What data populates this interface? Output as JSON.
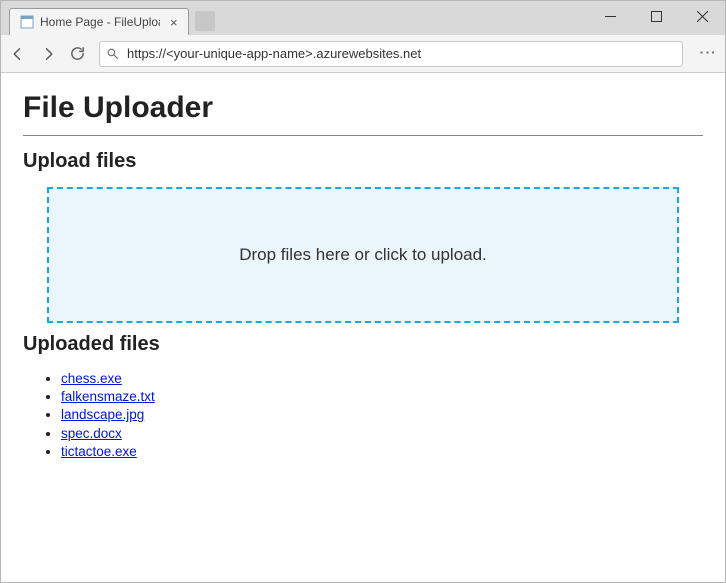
{
  "browser": {
    "tab_title": "Home Page - FileUploade",
    "url": "https://<your-unique-app-name>.azurewebsites.net"
  },
  "page": {
    "heading": "File Uploader",
    "upload_section_heading": "Upload files",
    "dropzone_text": "Drop files here or click to upload.",
    "uploaded_section_heading": "Uploaded files",
    "uploaded_files": [
      {
        "name": "chess.exe"
      },
      {
        "name": "falkensmaze.txt"
      },
      {
        "name": "landscape.jpg"
      },
      {
        "name": "spec.docx"
      },
      {
        "name": "tictactoe.exe"
      }
    ]
  }
}
